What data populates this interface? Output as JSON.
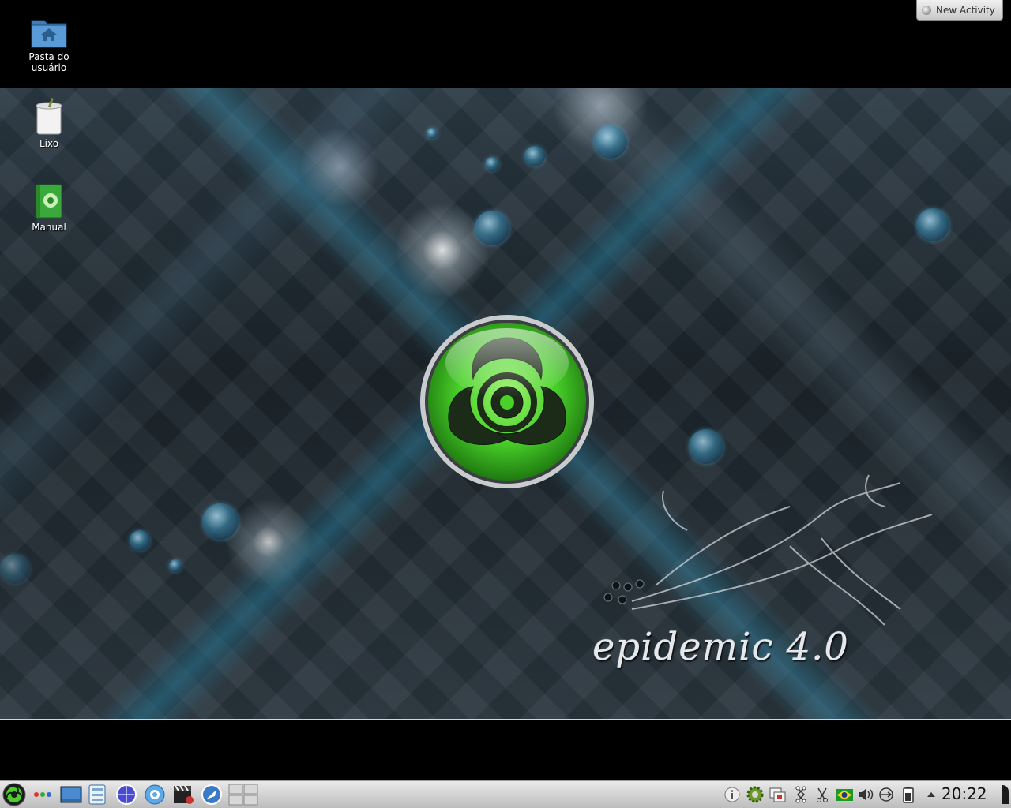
{
  "desktop": {
    "icons": [
      {
        "label_line1": "Pasta do",
        "label_line2": "usuário",
        "icon": "home-folder-icon"
      },
      {
        "label": "Lixo",
        "icon": "trash-icon"
      },
      {
        "label": "Manual",
        "icon": "manual-book-icon"
      }
    ],
    "wallpaper_text": "epidemic 4.0",
    "activity_button": "New Activity"
  },
  "taskbar": {
    "launcher_icon": "biohazard-menu-icon",
    "tasks": [
      "activities-icon",
      "show-desktop-icon",
      "file-manager-icon",
      "web-browser-icon",
      "help-icon",
      "media-player-icon",
      "install-icon",
      "pager-icon"
    ],
    "tray": [
      "info-icon",
      "settings-gear-icon",
      "window-list-icon",
      "network-icon",
      "scissors-icon",
      "brazil-flag-icon",
      "volume-icon",
      "usb-icon",
      "battery-icon",
      "tray-expand-icon"
    ],
    "clock": "20:22"
  },
  "colors": {
    "accent_green": "#49d12a",
    "taskbar_bg": "#d6d6d6"
  }
}
